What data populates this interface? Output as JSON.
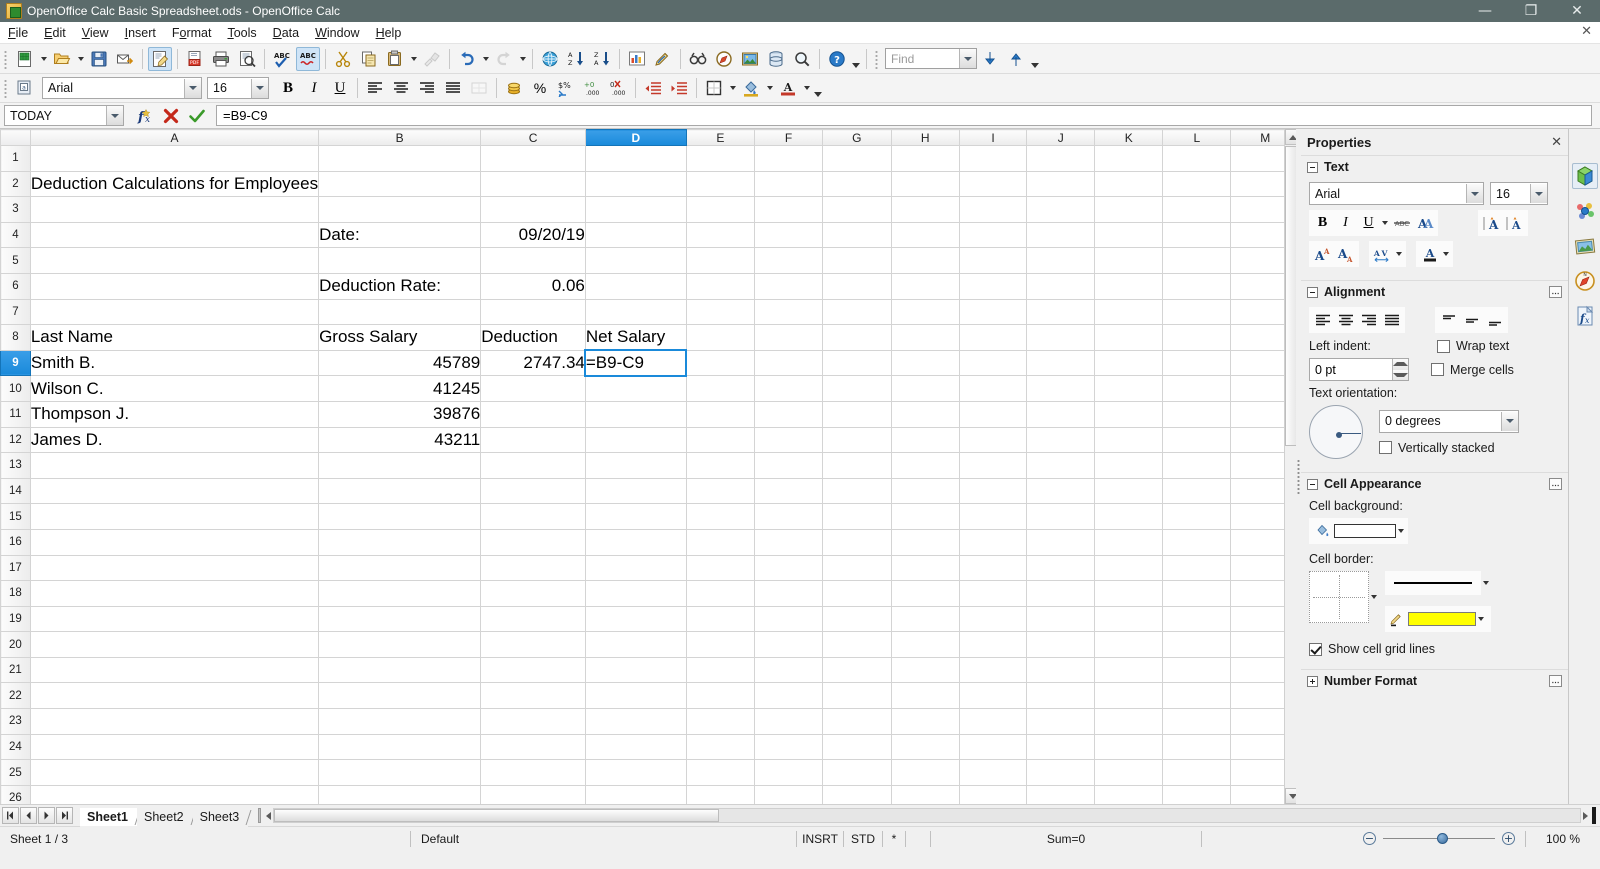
{
  "window": {
    "title": "OpenOffice Calc Basic Spreadsheet.ods - OpenOffice Calc",
    "minimize": "—",
    "maximize": "❐",
    "close": "✕",
    "doc_close": "✕"
  },
  "menubar": {
    "items": [
      "File",
      "Edit",
      "View",
      "Insert",
      "Format",
      "Tools",
      "Data",
      "Window",
      "Help"
    ]
  },
  "toolbars": {
    "standard": {
      "find_placeholder": "Find",
      "buttons": [
        "new-document",
        "open-document",
        "save-document",
        "email-document",
        "edit-file",
        "export-pdf",
        "print-file",
        "print-preview",
        "spelling",
        "autospellcheck",
        "cut",
        "copy",
        "paste",
        "clone-formatting",
        "undo",
        "redo",
        "hyperlink",
        "sort-ascending",
        "sort-descending",
        "insert-chart",
        "draw-functions",
        "find-replace",
        "navigator",
        "gallery",
        "data-sources",
        "zoom",
        "help"
      ]
    },
    "formatting": {
      "font_name": "Arial",
      "font_size": "16",
      "buttons": [
        "styles-and-formatting",
        "bold",
        "italic",
        "underline",
        "align-left",
        "align-center",
        "align-right",
        "justified",
        "merge-cells",
        "currency-format",
        "percent-format",
        "number-format-standard",
        "add-decimal-place",
        "delete-decimal-place",
        "decrease-indent",
        "increase-indent",
        "borders",
        "background-color",
        "font-color"
      ]
    }
  },
  "formula_bar": {
    "name_box": "TODAY",
    "function_wizard": "function-wizard",
    "cancel": "cancel",
    "accept": "accept",
    "input": "=B9-C9"
  },
  "grid": {
    "columns": [
      "A",
      "B",
      "C",
      "D",
      "E",
      "F",
      "G",
      "H",
      "I",
      "J",
      "K",
      "L",
      "M"
    ],
    "selected_column": "D",
    "selected_row": 9,
    "rows": [
      1,
      2,
      3,
      4,
      5,
      6,
      7,
      8,
      9,
      10,
      11,
      12,
      13,
      14,
      15,
      16,
      17,
      18,
      19,
      20,
      21,
      22,
      23,
      24,
      25,
      26
    ],
    "cells": [
      {
        "row": 2,
        "col": "A",
        "value": "Deduction Calculations for Employees",
        "align": "left"
      },
      {
        "row": 4,
        "col": "B",
        "value": "Date:",
        "align": "left"
      },
      {
        "row": 4,
        "col": "C",
        "value": "09/20/19",
        "align": "right"
      },
      {
        "row": 6,
        "col": "B",
        "value": "Deduction Rate:",
        "align": "left"
      },
      {
        "row": 6,
        "col": "C",
        "value": "0.06",
        "align": "right"
      },
      {
        "row": 8,
        "col": "A",
        "value": "Last Name",
        "align": "left"
      },
      {
        "row": 8,
        "col": "B",
        "value": "Gross Salary",
        "align": "left"
      },
      {
        "row": 8,
        "col": "C",
        "value": "Deduction",
        "align": "left"
      },
      {
        "row": 8,
        "col": "D",
        "value": "Net Salary",
        "align": "left"
      },
      {
        "row": 9,
        "col": "A",
        "value": "Smith B.",
        "align": "left"
      },
      {
        "row": 9,
        "col": "B",
        "value": "45789",
        "align": "right"
      },
      {
        "row": 9,
        "col": "C",
        "value": "2747.34",
        "align": "right"
      },
      {
        "row": 9,
        "col": "D",
        "value": "=B9-C9",
        "align": "left",
        "editing": true
      },
      {
        "row": 10,
        "col": "A",
        "value": "Wilson C.",
        "align": "left"
      },
      {
        "row": 10,
        "col": "B",
        "value": "41245",
        "align": "right"
      },
      {
        "row": 11,
        "col": "A",
        "value": "Thompson J.",
        "align": "left"
      },
      {
        "row": 11,
        "col": "B",
        "value": "39876",
        "align": "right"
      },
      {
        "row": 12,
        "col": "A",
        "value": "James D.",
        "align": "left"
      },
      {
        "row": 12,
        "col": "B",
        "value": "43211",
        "align": "right"
      }
    ]
  },
  "sidebar": {
    "title": "Properties",
    "close": "✕",
    "panels": {
      "text": {
        "title": "Text",
        "font_name": "Arial",
        "font_size": "16",
        "buttons": [
          "bold",
          "italic",
          "underline",
          "strikethrough",
          "shadow",
          "superscript",
          "subscript",
          "increase-font-size",
          "decrease-font-size",
          "character-spacing",
          "font-color"
        ]
      },
      "alignment": {
        "title": "Alignment",
        "left_indent_label": "Left indent:",
        "left_indent_value": "0 pt",
        "wrap_text_label": "Wrap text",
        "wrap_text_checked": false,
        "merge_cells_label": "Merge cells",
        "merge_cells_checked": false,
        "text_orientation_label": "Text orientation:",
        "orientation_value": "0 degrees",
        "vertically_stacked_label": "Vertically stacked",
        "vertically_stacked_checked": false,
        "h_align_buttons": [
          "align-left",
          "align-center",
          "align-right",
          "align-justified"
        ],
        "v_align_buttons": [
          "align-top",
          "align-middle",
          "align-bottom"
        ]
      },
      "cell_appearance": {
        "title": "Cell Appearance",
        "cell_background_label": "Cell background:",
        "cell_border_label": "Cell border:",
        "border_color": "#ffff00",
        "show_grid_label": "Show cell grid lines",
        "show_grid_checked": true
      },
      "number_format": {
        "title": "Number Format"
      }
    },
    "rail_tabs": [
      "properties-deck",
      "styles-deck",
      "gallery-deck",
      "navigator-deck",
      "functions-deck"
    ]
  },
  "sheet_bar": {
    "nav_first": "first-sheet",
    "nav_prev": "previous-sheet",
    "nav_next": "next-sheet",
    "nav_last": "last-sheet",
    "tabs": [
      "Sheet1",
      "Sheet2",
      "Sheet3"
    ],
    "active_tab": "Sheet1"
  },
  "status_bar": {
    "sheet_info": "Sheet 1 / 3",
    "page_style": "Default",
    "insert_mode": "INSRT",
    "selection_mode": "STD",
    "modified": "*",
    "sum": "Sum=0",
    "zoom_out": "−",
    "zoom_in": "+",
    "zoom_level": "100 %"
  },
  "colors": {
    "titlebar": "#5b6b6b",
    "selection": "#1a8ada",
    "border_highlight": "#ffff00"
  }
}
